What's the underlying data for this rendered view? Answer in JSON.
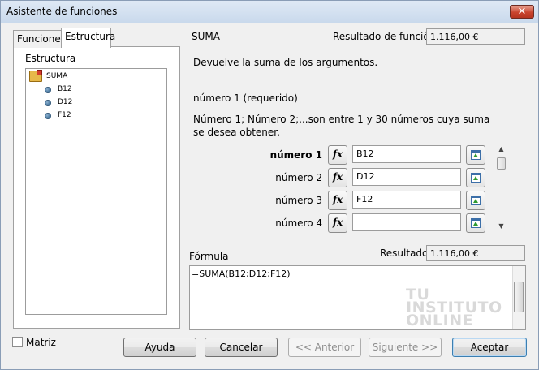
{
  "window": {
    "title": "Asistente de funciones",
    "close": "✕"
  },
  "tabs": [
    {
      "label": "Funciones"
    },
    {
      "label": "Estructura"
    }
  ],
  "structure": {
    "label": "Estructura",
    "root": "SUMA",
    "children": [
      "B12",
      "D12",
      "F12"
    ]
  },
  "function": {
    "name": "SUMA",
    "result_label": "Resultado de función",
    "result_value": "1.116,00 €",
    "description": "Devuelve la suma de los argumentos.",
    "arg_title": "número 1 (requerido)",
    "arg_description": "Número 1; Número 2;...son entre 1 y 30 números cuya suma se desea obtener."
  },
  "args": [
    {
      "label": "número 1",
      "value": "B12",
      "fx": "fx"
    },
    {
      "label": "número 2",
      "value": "D12",
      "fx": "fx"
    },
    {
      "label": "número 3",
      "value": "F12",
      "fx": "fx"
    },
    {
      "label": "número 4",
      "value": "",
      "fx": "fx"
    }
  ],
  "scroll": {
    "up": "▲",
    "down": "▼",
    "position": 0.1
  },
  "formula": {
    "label": "Fórmula",
    "text": "=SUMA(B12;D12;F12)",
    "result_label": "Resultado",
    "result_value": "1.116,00 €"
  },
  "watermark": {
    "line1": "TU",
    "line2": "INSTITUTO",
    "line3": "ONLINE"
  },
  "footer": {
    "array_label": "Matriz",
    "array_checked": false,
    "help": "Ayuda",
    "cancel": "Cancelar",
    "prev": "<< Anterior",
    "next": "Siguiente >>",
    "ok": "Aceptar"
  }
}
